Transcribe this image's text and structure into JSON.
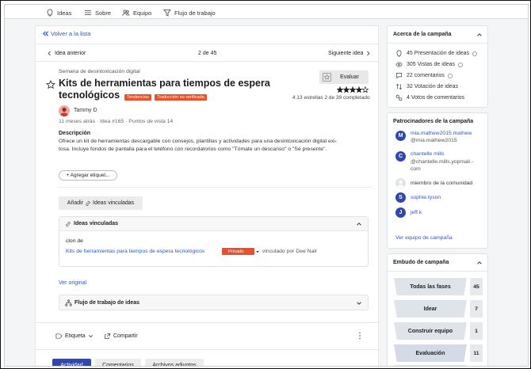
{
  "nav": {
    "ideas": "Ideas",
    "about": "Sobre",
    "team": "Equipo",
    "workflow": "Flujo de trabajo"
  },
  "back_link": "Volver a la lista",
  "pager": {
    "prev": "Idea anterior",
    "position": "2 de 45",
    "next": "Siguiente idea"
  },
  "idea": {
    "campaign": "Semana de desintoxicación digital",
    "title_line1": "Kits de herramientas para tiempos de espera",
    "title_line2": "tecnológicos",
    "tag_trending": "Tendencias",
    "tag_translation": "Traducción no verificada",
    "author": "Tammy D",
    "meta": "11 meses atrás · Idea #165 · Puntos de vista 14",
    "description_heading": "Descripción",
    "description_line1": "Ofrece un kit de herramientas descargable con consejos, plantillas y actividades para una desintoxicación digital exi-",
    "description_line2": "tosa. Incluye fondos de pantalla para el teléfono con recordatorios como \"Tómate un descanso\" o \"Sé presente\".",
    "add_tag": "+ Agregar etiquet...",
    "rating_text": "4.13 estrellas 2 de 39 completado",
    "rating_value": 4.13,
    "rating_max": 5,
    "evaluate_label": "Evaluar"
  },
  "linked": {
    "add_button": "Añadir",
    "add_button_rest": "Ideas vinculadas",
    "panel_title": "Ideas vinculadas",
    "clone_label": "clon de",
    "linked_title": "Kits de herramientas para tiempos de espera tecnológicos",
    "privacy": "Privado",
    "linked_by": "vinculado por Dee Nair",
    "view_original": "Ver original"
  },
  "workflow_panel": "Flujo de trabajo de ideas",
  "actions": {
    "label": "Etiqueta",
    "share": "Compartir"
  },
  "tabs": [
    "Actividad",
    "Comentarios",
    "Archivos adjuntos"
  ],
  "about_campaign": {
    "title": "Acerca de la campaña",
    "stats": [
      {
        "icon": "bulb-icon",
        "text": "45 Presentación de ideas"
      },
      {
        "icon": "eye-icon",
        "text": "305 Vistas de ideas"
      },
      {
        "icon": "comment-icon",
        "text": "22 comentarios"
      },
      {
        "icon": "vote-icon",
        "text": "32 Votación de ideas"
      },
      {
        "icon": "votes-comment-icon",
        "text": "4 Votos de comentarios"
      }
    ]
  },
  "sponsors": {
    "title": "Patrocinadores de la campaña",
    "list": [
      {
        "initial": "M",
        "name": "mia.mathew2015 mathew",
        "email": "@mia.mathew2015"
      },
      {
        "initial": "C",
        "name": "chantelle mills",
        "email": "@chantelle.mills.yopmail.-com"
      },
      {
        "initial": "",
        "name": "miembro de la comunidad",
        "email": ""
      },
      {
        "initial": "S",
        "name": "sophie.tyson",
        "email": ""
      },
      {
        "initial": "J",
        "name": "jeff.k",
        "email": ""
      }
    ],
    "view_team": "Ver equipo de campaña"
  },
  "funnel": {
    "title": "Embudo de campaña",
    "rows": [
      {
        "label": "Todas las fases",
        "count": "45"
      },
      {
        "label": "Idear",
        "count": "7"
      },
      {
        "label": "Construir equipo",
        "count": "1"
      },
      {
        "label": "Evaluación",
        "count": "11"
      }
    ]
  },
  "colors": {
    "accent": "#2e48ad",
    "link": "#2a57c8",
    "tag": "#e8512d"
  }
}
